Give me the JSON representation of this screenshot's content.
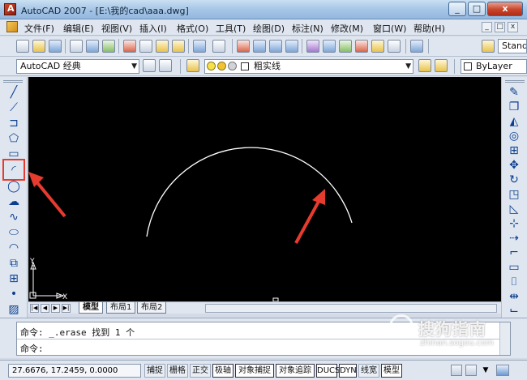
{
  "window": {
    "title": "AutoCAD 2007 - [E:\\我的cad\\aaa.dwg]",
    "buttons": {
      "minimize": "_",
      "maximize": "□",
      "close": "x"
    }
  },
  "menu": {
    "items": [
      "文件(F)",
      "编辑(E)",
      "视图(V)",
      "插入(I)",
      "格式(O)",
      "工具(T)",
      "绘图(D)",
      "标注(N)",
      "修改(M)",
      "窗口(W)",
      "帮助(H)"
    ],
    "mdi_buttons": [
      "_",
      "□",
      "x"
    ]
  },
  "toolbar1": {
    "style_combo": "Stand"
  },
  "toolbar2": {
    "workspace": "AutoCAD 经典",
    "layer": "粗实线",
    "color_combo": "ByLayer"
  },
  "canvas": {
    "ucs_x_label": "X",
    "ucs_y_label": "Y",
    "accent_arrow_color": "#e63b2e",
    "highlight_box_color": "#e63b2e"
  },
  "layout_tabs": [
    "模型",
    "布局1",
    "布局2"
  ],
  "command": {
    "line1": "命令: _.erase 找到 1 个",
    "line2": "命令:"
  },
  "status": {
    "coords": "27.6676, 17.2459, 0.0000",
    "toggles": [
      {
        "label": "捕捉",
        "on": false
      },
      {
        "label": "栅格",
        "on": false
      },
      {
        "label": "正交",
        "on": false
      },
      {
        "label": "极轴",
        "on": true
      },
      {
        "label": "对象捕捉",
        "on": true
      },
      {
        "label": "对象追踪",
        "on": true
      },
      {
        "label": "DUCS",
        "on": true
      },
      {
        "label": "DYN",
        "on": true
      },
      {
        "label": "线宽",
        "on": false
      },
      {
        "label": "模型",
        "on": true
      }
    ]
  },
  "watermark": {
    "text": "搜狗指南",
    "url": "zhinan.sogou.com"
  },
  "icons": {
    "left": [
      "line-icon",
      "construction-line-icon",
      "polyline-icon",
      "polygon-icon",
      "rectangle-icon",
      "arc-icon",
      "circle-icon",
      "revision-cloud-icon",
      "spline-icon",
      "ellipse-icon",
      "ellipse-arc-icon",
      "insert-block-icon",
      "make-block-icon",
      "point-icon",
      "hatch-icon"
    ],
    "right": [
      "erase-icon",
      "copy-icon",
      "mirror-icon",
      "offset-icon",
      "array-icon",
      "move-icon",
      "rotate-icon",
      "scale-icon",
      "stretch-icon",
      "trim-icon",
      "extend-icon",
      "break-icon",
      "join-icon",
      "chamfer-icon",
      "fillet-icon",
      "explode-icon"
    ]
  }
}
